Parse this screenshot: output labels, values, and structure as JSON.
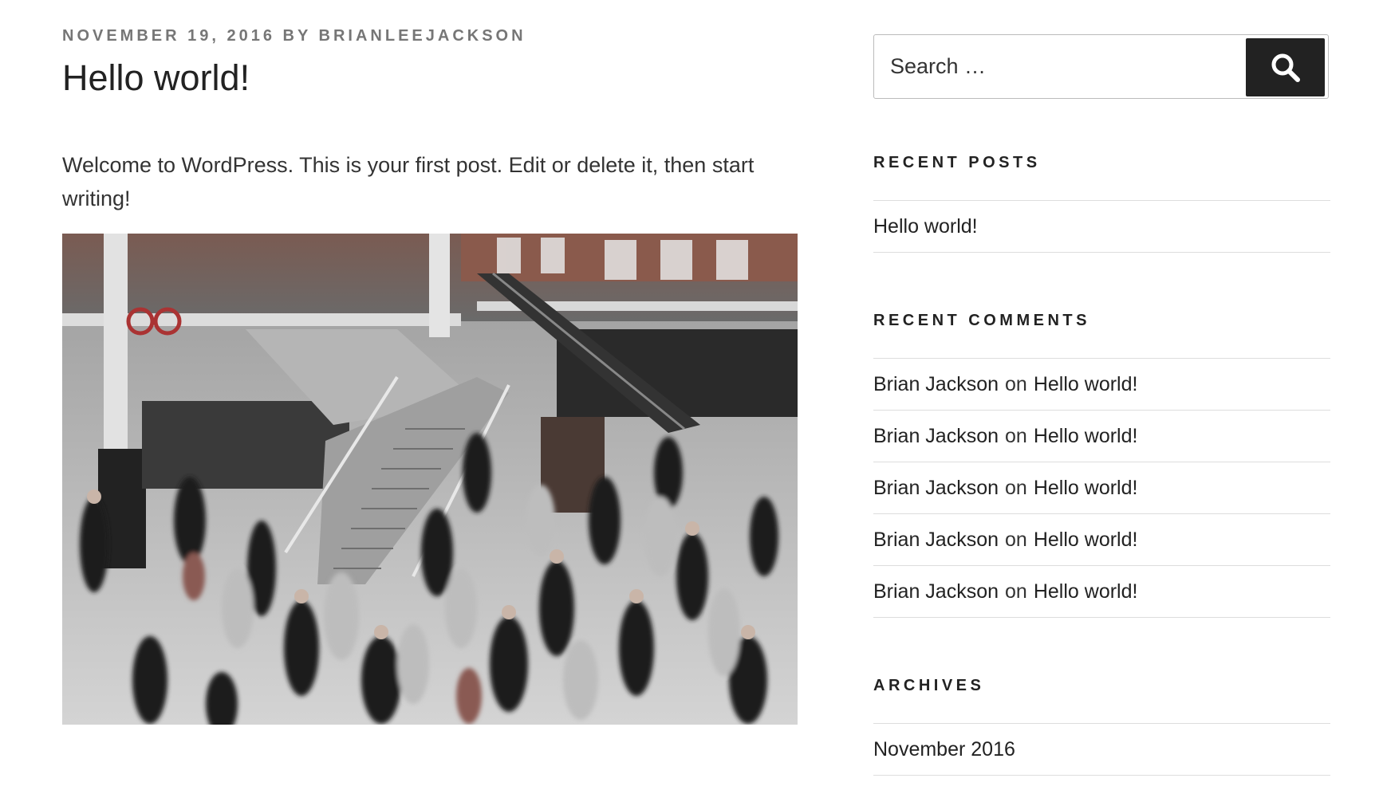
{
  "post": {
    "meta_date": "November 19, 2016",
    "meta_by": "by",
    "meta_author": "brianleejackson",
    "title": "Hello world!",
    "body": "Welcome to WordPress. This is your first post. Edit or delete it, then start writing!",
    "image": {
      "subject": "blurred crowd of commuters in a busy train station concourse with escalators and stairs",
      "style": "grayscale with muted red accents"
    }
  },
  "search": {
    "placeholder": "Search …",
    "button_icon": "search-icon"
  },
  "recent_posts": {
    "title": "Recent Posts",
    "items": [
      {
        "label": "Hello world!"
      }
    ]
  },
  "recent_comments": {
    "title": "Recent Comments",
    "items": [
      {
        "author": "Brian Jackson",
        "on": "on",
        "post": "Hello world!"
      },
      {
        "author": "Brian Jackson",
        "on": "on",
        "post": "Hello world!"
      },
      {
        "author": "Brian Jackson",
        "on": "on",
        "post": "Hello world!"
      },
      {
        "author": "Brian Jackson",
        "on": "on",
        "post": "Hello world!"
      },
      {
        "author": "Brian Jackson",
        "on": "on",
        "post": "Hello world!"
      }
    ]
  },
  "archives": {
    "title": "Archives",
    "items": [
      {
        "label": "November 2016"
      }
    ]
  },
  "colors": {
    "button_bg": "#222222",
    "text": "#222222",
    "meta": "#767676",
    "divider": "#dddddd"
  }
}
